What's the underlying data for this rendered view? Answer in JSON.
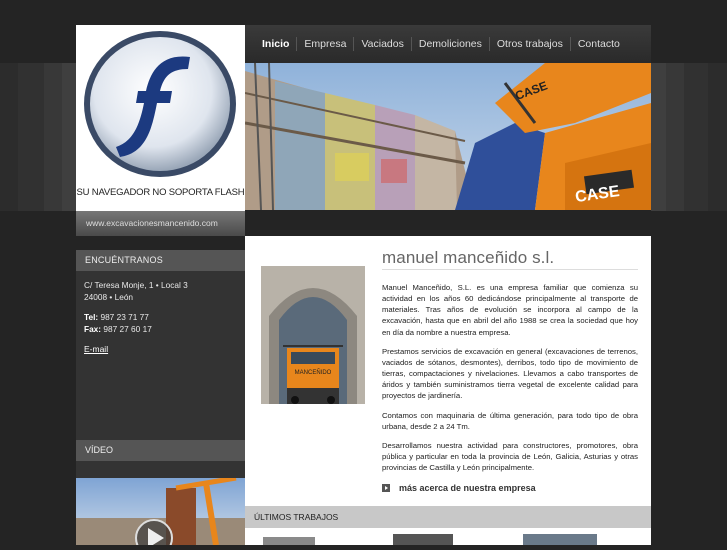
{
  "flash": {
    "notice": "SU NAVEGADOR NO SOPORTA FLASH"
  },
  "site_url": "www.excavacionesmancenido.com",
  "nav": [
    {
      "label": "Inicio"
    },
    {
      "label": "Empresa"
    },
    {
      "label": "Vaciados"
    },
    {
      "label": "Demoliciones"
    },
    {
      "label": "Otros trabajos"
    },
    {
      "label": "Contacto"
    }
  ],
  "sidebar": {
    "heading": "ENCUÉNTRANOS",
    "address_line1": "C/ Teresa Monje, 1 • Local 3",
    "address_line2": "24008 • León",
    "tel_label": "Tel:",
    "tel_value": "987 23 71 77",
    "fax_label": "Fax:",
    "fax_value": "987 27 60 17",
    "email_label": "E-mail"
  },
  "video": {
    "heading": "VÍDEO"
  },
  "content": {
    "title": "manuel manceñido s.l.",
    "paragraphs": [
      "Manuel Manceñido, S.L. es una empresa familiar que comienza su actividad en los años 60 dedicándose principalmente al transporte de materiales. Tras años de evolución se incorpora al campo de la excavación, hasta que en abril del año 1988 se crea la sociedad que hoy en día da nombre a nuestra empresa.",
      "Prestamos servicios de excavación en general (excavaciones de terrenos, vaciados de sótanos, desmontes), derribos, todo tipo de movimiento de tierras, compactaciones y nivelaciones. Llevamos a cabo transportes de áridos y también suministramos tierra vegetal de excelente calidad para proyectos de jardinería.",
      "Contamos con maquinaria de última generación, para todo tipo de obra urbana, desde 2 a 24 Tm.",
      "Desarrollamos nuestra actividad para constructores, promotores, obra pública y particular en toda la provincia de León, Galicia, Asturias y otras provincias de Castilla y León principalmente."
    ],
    "more_link": "más acerca de nuestra empresa"
  },
  "recent": {
    "heading": "ÚLTIMOS TRABAJOS"
  },
  "hero": {
    "machine_brand": "CASE"
  },
  "photo": {
    "truck_label": "MANCEÑIDO"
  },
  "colors": {
    "background": "#242424",
    "nav": "#2f2f2f",
    "sidebar": "#333333",
    "accent_orange": "#e8861c"
  }
}
